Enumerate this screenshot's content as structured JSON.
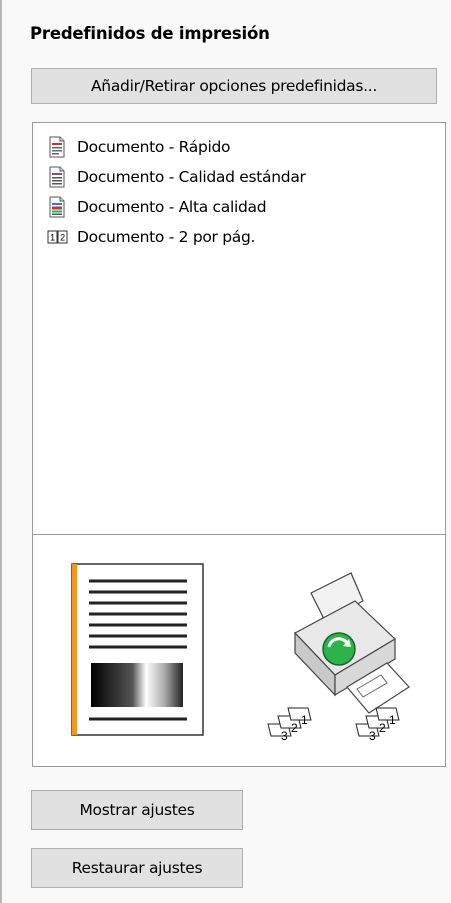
{
  "panel": {
    "title": "Predefinidos de impresión",
    "add_remove_button": "Añadir/Retirar opciones predefinidas...",
    "presets": [
      {
        "label": "Documento - Rápido",
        "icon": "document-fast-icon"
      },
      {
        "label": "Documento - Calidad estándar",
        "icon": "document-standard-icon"
      },
      {
        "label": "Documento - Alta calidad",
        "icon": "document-high-quality-icon"
      },
      {
        "label": "Documento - 2 por pág.",
        "icon": "two-per-page-icon"
      }
    ],
    "show_settings_button": "Mostrar ajustes",
    "reset_settings_button": "Restaurar ajustes"
  },
  "preview": {
    "page_icon": "document-page-preview-icon",
    "printer_icon": "printer-icon",
    "collate_icon": "collated-pages-icon",
    "collate_labels": [
      "1",
      "2",
      "3"
    ],
    "accent_color": "#f7941d"
  }
}
